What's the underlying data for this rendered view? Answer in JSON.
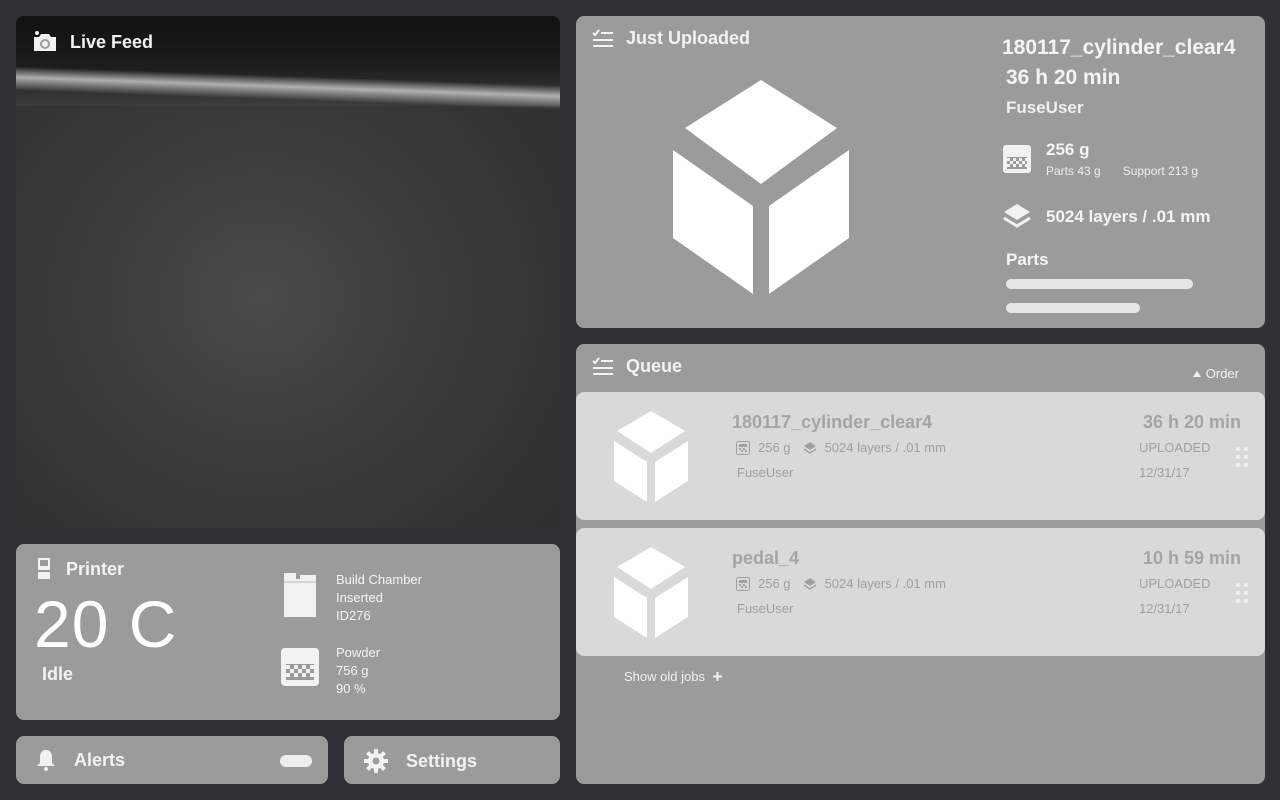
{
  "live_feed": {
    "title": "Live Feed"
  },
  "just_uploaded": {
    "title": "Just Uploaded",
    "job_name": "180117_cylinder_clear4",
    "duration": "36 h 20 min",
    "user": "FuseUser",
    "weight": "256 g",
    "parts_weight": "Parts 43 g",
    "support_weight": "Support 213 g",
    "layers": "5024 layers / .01 mm",
    "parts_label": "Parts"
  },
  "printer": {
    "title": "Printer",
    "temperature": "20 C",
    "state": "Idle",
    "chamber": {
      "line1": "Build Chamber",
      "line2": "Inserted",
      "line3": "ID276"
    },
    "powder": {
      "line1": "Powder",
      "line2": "756 g",
      "line3": "90 %"
    }
  },
  "alerts": {
    "title": "Alerts"
  },
  "settings": {
    "title": "Settings"
  },
  "queue": {
    "title": "Queue",
    "order_label": "Order",
    "show_old_label": "Show old jobs",
    "jobs": [
      {
        "name": "180117_cylinder_clear4",
        "weight": "256 g",
        "layers": "5024 layers / .01 mm",
        "user": "FuseUser",
        "duration": "36 h 20 min",
        "status": "UPLOADED",
        "date": "12/31/17"
      },
      {
        "name": "pedal_4",
        "weight": "256 g",
        "layers": "5024 layers / .01 mm",
        "user": "FuseUser",
        "duration": "10 h 59 min",
        "status": "UPLOADED",
        "date": "12/31/17"
      }
    ]
  }
}
